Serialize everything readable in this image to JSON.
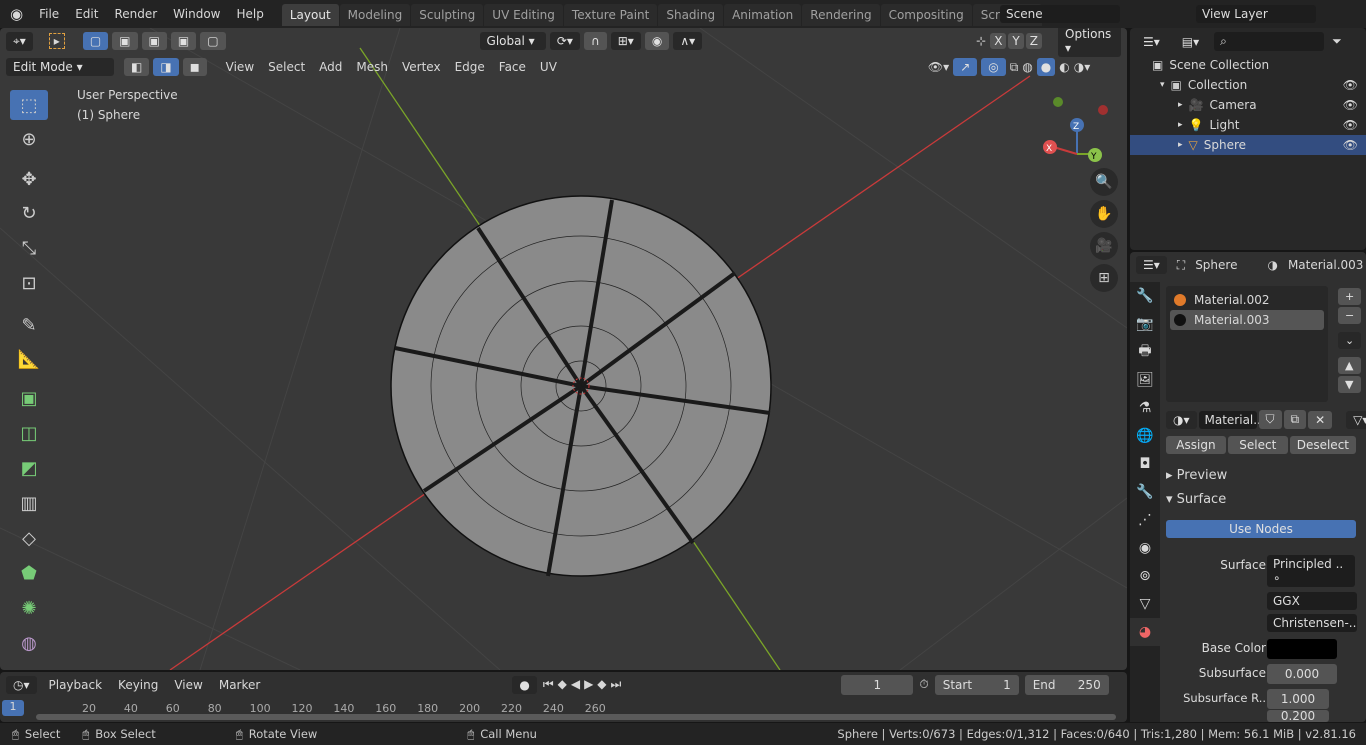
{
  "topbar": {
    "menus": [
      "File",
      "Edit",
      "Render",
      "Window",
      "Help"
    ],
    "workspaces": [
      "Layout",
      "Modeling",
      "Sculpting",
      "UV Editing",
      "Texture Paint",
      "Shading",
      "Animation",
      "Rendering",
      "Compositing",
      "Scripting"
    ],
    "active_workspace": "Layout",
    "scene": "Scene",
    "view_layer": "View Layer"
  },
  "viewport": {
    "mode": "Edit Mode",
    "menus": [
      "View",
      "Select",
      "Add",
      "Mesh",
      "Vertex",
      "Edge",
      "Face",
      "UV"
    ],
    "orientation": "Global",
    "options": "Options",
    "overlay_text1": "User Perspective",
    "overlay_text2": "(1) Sphere",
    "gizmo": {
      "x": "X",
      "y": "Y",
      "z": "Z"
    },
    "xyz": [
      "X",
      "Y",
      "Z"
    ]
  },
  "outliner": {
    "root": "Scene Collection",
    "items": [
      {
        "label": "Collection"
      },
      {
        "label": "Camera"
      },
      {
        "label": "Light"
      },
      {
        "label": "Sphere",
        "selected": true
      }
    ]
  },
  "properties": {
    "object": "Sphere",
    "material": "Material.003",
    "slots": [
      {
        "label": "Material.002",
        "color": "#e07a2a"
      },
      {
        "label": "Material.003",
        "color": "#111111",
        "selected": true
      }
    ],
    "material_field": "Material..",
    "buttons": [
      "Assign",
      "Select",
      "Deselect"
    ],
    "panels": {
      "preview": "Preview",
      "surface": "Surface"
    },
    "use_nodes": "Use Nodes",
    "rows": {
      "surface_label": "Surface",
      "surface_value": "Principled ..",
      "distribution": "GGX",
      "subsurface_method": "Christensen-..",
      "base_color_label": "Base Color",
      "base_color": "#000000",
      "subsurface_label": "Subsurface",
      "subsurface_value": "0.000",
      "subsurface_r_label": "Subsurface R..",
      "subsurface_r1": "1.000",
      "subsurface_r2": "0.200"
    }
  },
  "timeline": {
    "menus": [
      "Playback",
      "Keying",
      "View",
      "Marker"
    ],
    "current_frame": "1",
    "start_label": "Start",
    "start": "1",
    "end_label": "End",
    "end": "250",
    "ticks": [
      "20",
      "40",
      "60",
      "80",
      "100",
      "120",
      "140",
      "160",
      "180",
      "200",
      "220",
      "240",
      "260"
    ],
    "frame_marker": "1"
  },
  "status": {
    "select": "Select",
    "box_select": "Box Select",
    "rotate": "Rotate View",
    "call_menu": "Call Menu",
    "stats": "Sphere | Verts:0/673 | Edges:0/1,312 | Faces:0/640 | Tris:1,280 | Mem: 56.1 MiB | v2.81.16"
  },
  "colors": {
    "accent": "#4772b3",
    "x_axis": "#c83a3a",
    "y_axis": "#7aa528",
    "background": "#393939"
  }
}
